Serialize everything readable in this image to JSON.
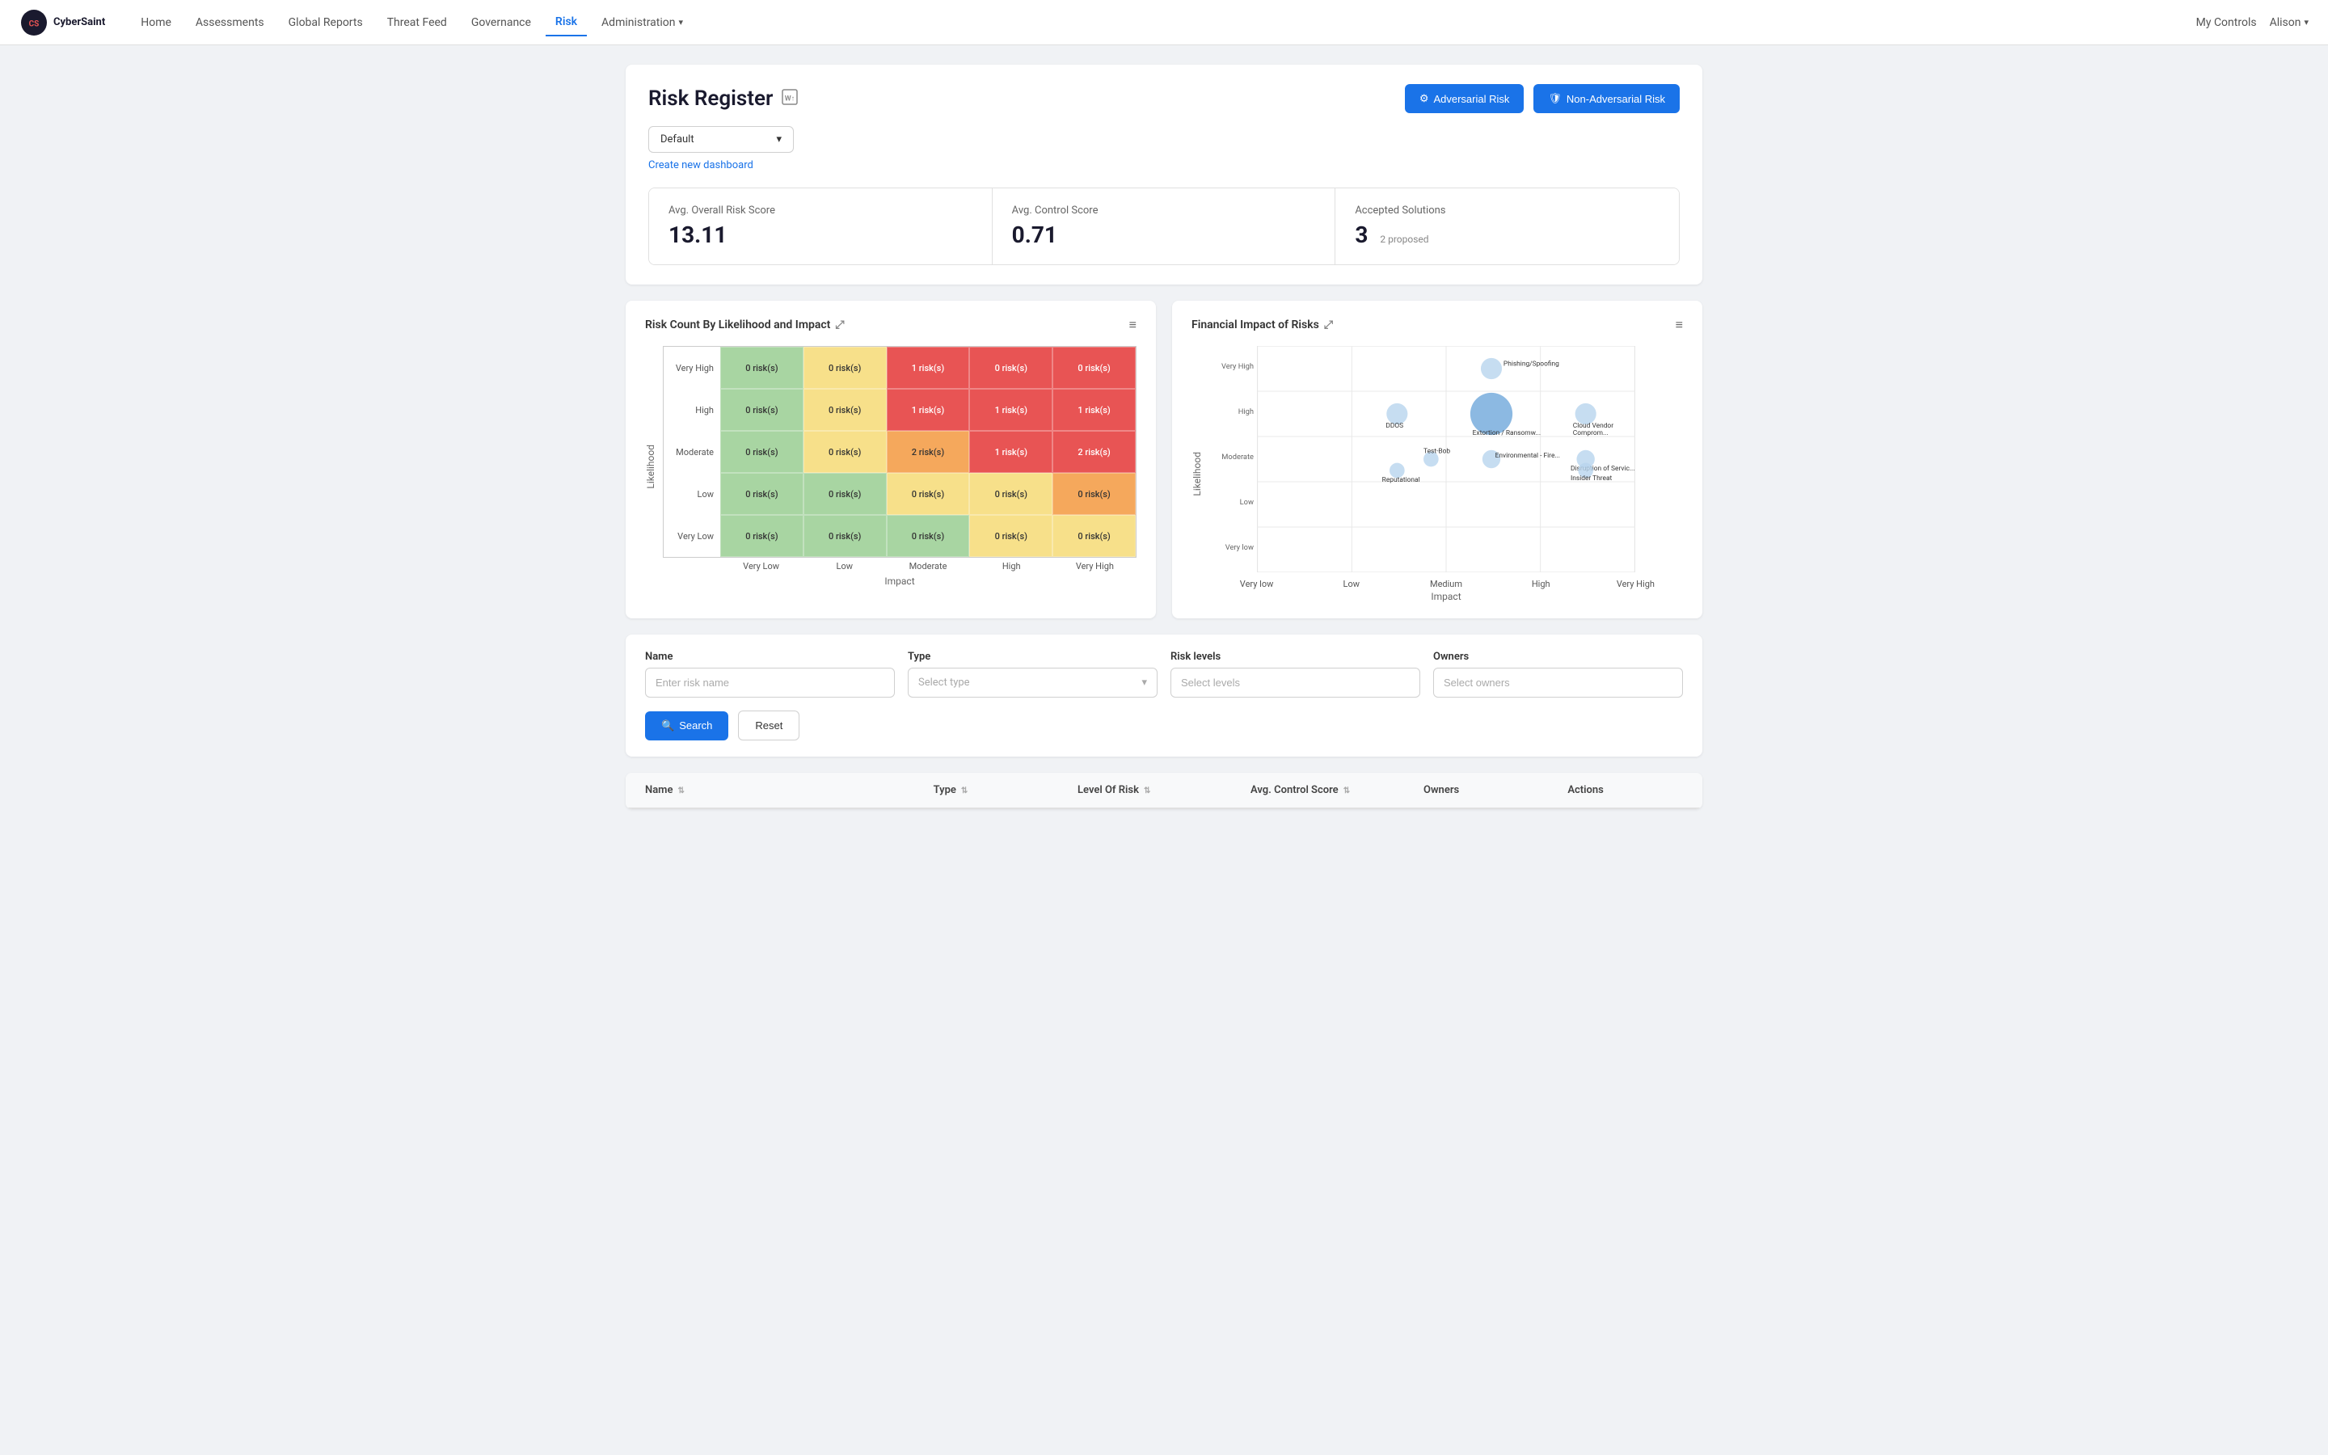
{
  "brand": {
    "name": "CyberSaint",
    "logo_text": "CS"
  },
  "nav": {
    "links": [
      {
        "label": "Home",
        "active": false
      },
      {
        "label": "Assessments",
        "active": false
      },
      {
        "label": "Global Reports",
        "active": false
      },
      {
        "label": "Threat Feed",
        "active": false
      },
      {
        "label": "Governance",
        "active": false
      },
      {
        "label": "Risk",
        "active": true
      },
      {
        "label": "Administration",
        "active": false,
        "has_arrow": true
      }
    ],
    "right": [
      {
        "label": "My Controls"
      },
      {
        "label": "Alison",
        "has_arrow": true
      }
    ]
  },
  "page": {
    "title": "Risk Register",
    "buttons": [
      {
        "label": "Adversarial Risk",
        "icon": "⚙"
      },
      {
        "label": "Non-Adversarial Risk",
        "icon": "🛡"
      }
    ]
  },
  "dashboard": {
    "dropdown_label": "Default",
    "create_link": "Create new dashboard"
  },
  "stats": [
    {
      "label": "Avg. Overall Risk Score",
      "value": "13.11",
      "sub": ""
    },
    {
      "label": "Avg. Control Score",
      "value": "0.71",
      "sub": ""
    },
    {
      "label": "Accepted Solutions",
      "value": "3",
      "sub": "2 proposed"
    }
  ],
  "charts": {
    "matrix": {
      "title": "Risk Count By Likelihood and Impact",
      "y_label": "Likelihood",
      "x_label": "Impact",
      "row_labels": [
        "Very High",
        "High",
        "Moderate",
        "Low",
        "Very Low"
      ],
      "col_labels": [
        "Very Low",
        "Low",
        "Moderate",
        "High",
        "Very High"
      ],
      "cells": [
        [
          "0 risk(s)",
          "0 risk(s)",
          "1 risk(s)",
          "0 risk(s)",
          "0 risk(s)"
        ],
        [
          "0 risk(s)",
          "0 risk(s)",
          "1 risk(s)",
          "1 risk(s)",
          "1 risk(s)"
        ],
        [
          "0 risk(s)",
          "0 risk(s)",
          "2 risk(s)",
          "1 risk(s)",
          "2 risk(s)"
        ],
        [
          "0 risk(s)",
          "0 risk(s)",
          "0 risk(s)",
          "0 risk(s)",
          "0 risk(s)"
        ],
        [
          "0 risk(s)",
          "0 risk(s)",
          "0 risk(s)",
          "0 risk(s)",
          "0 risk(s)"
        ]
      ],
      "cell_colors": [
        [
          "green",
          "yellow",
          "red",
          "red",
          "red"
        ],
        [
          "green",
          "yellow",
          "red",
          "red",
          "red"
        ],
        [
          "green",
          "yellow",
          "orange",
          "red",
          "red"
        ],
        [
          "green",
          "green",
          "yellow",
          "yellow",
          "orange"
        ],
        [
          "green",
          "green",
          "green",
          "yellow",
          "yellow"
        ]
      ]
    },
    "financial": {
      "title": "Financial Impact of Risks",
      "y_label": "Likelihood",
      "x_label": "Impact",
      "y_labels": [
        "Very High",
        "High",
        "Moderate",
        "Low",
        "Very low"
      ],
      "x_labels": [
        "Very low",
        "Low",
        "Medium",
        "High",
        "Very High"
      ],
      "bubbles": [
        {
          "label": "Phishing/Spoofing",
          "x": 0.62,
          "y": 0.9,
          "r": 12,
          "color": "#a8c8f0"
        },
        {
          "label": "DDOS",
          "x": 0.37,
          "y": 0.72,
          "r": 14,
          "color": "#a8c8f0"
        },
        {
          "label": "Extortion / Ransomw...",
          "x": 0.62,
          "y": 0.72,
          "r": 28,
          "color": "#5b9bd5"
        },
        {
          "label": "Cloud Vendor Comprom...",
          "x": 0.87,
          "y": 0.72,
          "r": 14,
          "color": "#a8c8f0"
        },
        {
          "label": "Test-Bob",
          "x": 0.46,
          "y": 0.54,
          "r": 10,
          "color": "#a8c8f0"
        },
        {
          "label": "Environmental - Fire...",
          "x": 0.62,
          "y": 0.54,
          "r": 12,
          "color": "#a8c8f0"
        },
        {
          "label": "Disruption of Servic...",
          "x": 0.87,
          "y": 0.54,
          "r": 12,
          "color": "#a8c8f0"
        },
        {
          "label": "Reputational",
          "x": 0.37,
          "y": 0.54,
          "r": 10,
          "color": "#a8c8f0"
        },
        {
          "label": "Insider Threat",
          "x": 0.87,
          "y": 0.54,
          "r": 10,
          "color": "#a8c8f0"
        }
      ]
    }
  },
  "filters": {
    "name_label": "Name",
    "name_placeholder": "Enter risk name",
    "type_label": "Type",
    "type_placeholder": "Select type",
    "risk_label": "Risk levels",
    "risk_placeholder": "Select levels",
    "owners_label": "Owners",
    "owners_placeholder": "Select owners",
    "search_btn": "Search",
    "reset_btn": "Reset"
  },
  "table": {
    "columns": [
      "Name",
      "Type",
      "Level Of Risk",
      "Avg. Control Score",
      "Owners",
      "Actions"
    ]
  },
  "colors": {
    "primary": "#1a73e8",
    "cell_green": "#a8d5a2",
    "cell_yellow": "#f7e08a",
    "cell_orange": "#f5a85c",
    "cell_red": "#e85454"
  }
}
